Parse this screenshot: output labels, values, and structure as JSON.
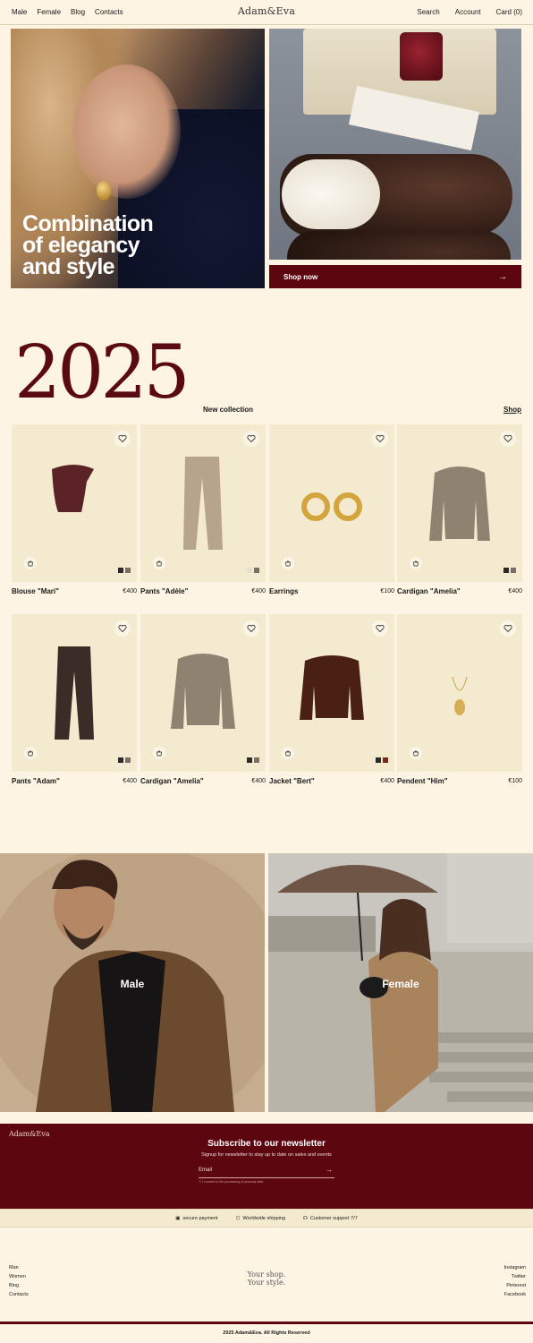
{
  "header": {
    "nav_left": [
      "Male",
      "Female",
      "Blog",
      "Contacts"
    ],
    "logo": "Adam&Eva",
    "nav_right": [
      "Search",
      "Account",
      "Card (0)"
    ]
  },
  "hero": {
    "title_lines": [
      "Combination",
      "of elegancy",
      "and style"
    ],
    "shop_button": "Shop now",
    "arrow": "→"
  },
  "collection": {
    "year": "2025",
    "label": "New collection",
    "shop_link": "Shop"
  },
  "products": [
    {
      "name": "Blouse \"Mari\"",
      "price": "€400",
      "swatches": [
        "#2b2b2b",
        "#7a6e66"
      ]
    },
    {
      "name": "Pants \"Adèle\"",
      "price": "€400",
      "swatches": [
        "#e6dfd2",
        "#7a6e66"
      ]
    },
    {
      "name": "Earrings",
      "price": "€100",
      "swatches": []
    },
    {
      "name": "Cardigan \"Amelia\"",
      "price": "€400",
      "swatches": [
        "#2b2b2b",
        "#7a6e66"
      ]
    },
    {
      "name": "Pants \"Adam\"",
      "price": "€400",
      "swatches": [
        "#2b2b2b",
        "#7a6e66"
      ]
    },
    {
      "name": "Cardigan \"Amelia\"",
      "price": "€400",
      "swatches": [
        "#2b2b2b",
        "#7a6e66"
      ]
    },
    {
      "name": "Jacket \"Bert\"",
      "price": "€400",
      "swatches": [
        "#2b2b2b",
        "#7a2a1a"
      ]
    },
    {
      "name": "Pendent \"Him\"",
      "price": "€100",
      "swatches": []
    }
  ],
  "categories": {
    "male": "Male",
    "female": "Female"
  },
  "newsletter": {
    "logo": "Adam&Eva",
    "title": "Subscribe to our newsletter",
    "subtitle": "Signup for newsletter to stay up to date on sales and events",
    "email_placeholder": "Email",
    "consent": "I consent to the processing of personal data"
  },
  "features": [
    "secure payment",
    "Worldwide shipping",
    "Customer support 7/7"
  ],
  "footer": {
    "left_links": [
      "Man",
      "Women",
      "Blog",
      "Contacts"
    ],
    "slogan_lines": [
      "Your shop.",
      "Your style."
    ],
    "right_links": [
      "Instagram",
      "Twitter",
      "Pinterest",
      "Facebook"
    ],
    "copyright": "2025 Adam&Eva. All Rights Reserved"
  },
  "colors": {
    "background": "#fdf4e3",
    "accent": "#5c0710",
    "card": "#f3ead0"
  }
}
